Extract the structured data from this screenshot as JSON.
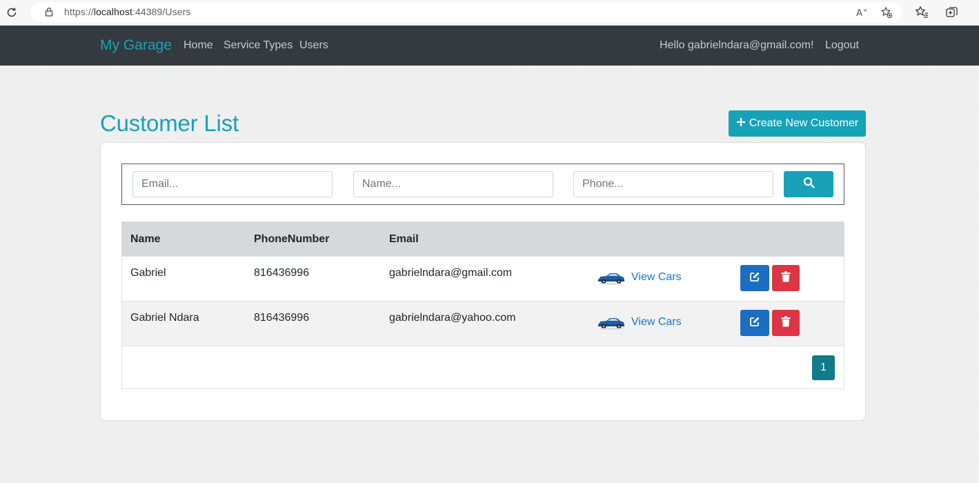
{
  "browser": {
    "url_prefix": "https://",
    "url_host": "localhost",
    "url_rest": ":44389/Users"
  },
  "navbar": {
    "brand": "My Garage",
    "links": [
      "Home",
      "Service Types",
      "Users"
    ],
    "greeting": "Hello gabrielndara@gmail.com!",
    "logout": "Logout"
  },
  "page": {
    "title": "Customer List",
    "create_button": "Create New Customer"
  },
  "search": {
    "email_placeholder": "Email...",
    "name_placeholder": "Name...",
    "phone_placeholder": "Phone..."
  },
  "table": {
    "headers": [
      "Name",
      "PhoneNumber",
      "Email"
    ],
    "rows": [
      {
        "name": "Gabriel",
        "phone": "816436996",
        "email": "gabrielndara@gmail.com",
        "link": "View Cars"
      },
      {
        "name": "Gabriel Ndara",
        "phone": "816436996",
        "email": "gabrielndara@yahoo.com",
        "link": "View Cars"
      }
    ]
  },
  "pagination": {
    "current_page": "1"
  },
  "colors": {
    "accent": "#17a2b8",
    "navbar": "#343a40",
    "edit": "#1b6ec2",
    "delete": "#dc3545"
  },
  "icons": [
    "reload-icon",
    "lock-icon",
    "read-aloud-icon",
    "add-favorite-icon",
    "favorites-icon",
    "collections-icon",
    "plus-icon",
    "search-icon",
    "car-icon",
    "edit-icon",
    "trash-icon"
  ]
}
